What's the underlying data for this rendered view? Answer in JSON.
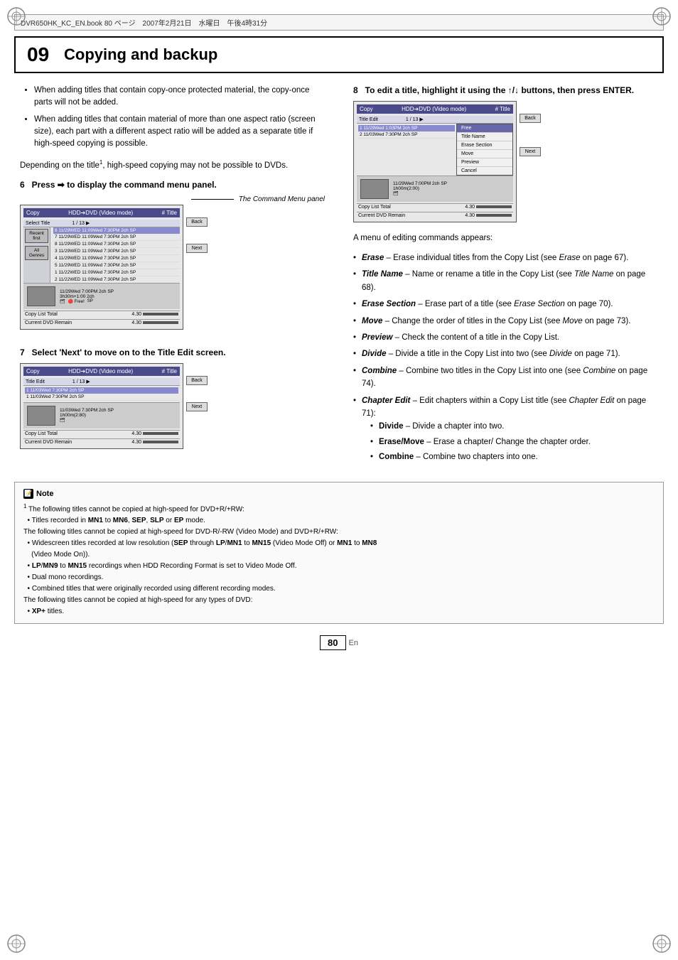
{
  "page": {
    "top_bar_text": "DVR650HK_KC_EN.book  80 ページ　2007年2月21日　水曜日　午後4時31分",
    "chapter_num": "09",
    "chapter_title": "Copying and backup",
    "page_number": "80",
    "page_lang": "En"
  },
  "left_col": {
    "bullets": [
      "When adding titles that contain copy-once protected material, the copy-once parts will not be added.",
      "When adding titles that contain material of more than one aspect ratio (screen size), each part with a different aspect ratio will be added as a separate title if high-speed copying is possible."
    ],
    "para1": "Depending on the title¹, high-speed copying may not be possible to DVDs.",
    "step6": {
      "label": "6",
      "heading": "Press ➡ to display the command menu panel.",
      "panel_label": "The Command Menu panel",
      "panel": {
        "title_left": "Copy",
        "title_mid": "HDD➔DVD (Video mode)",
        "title_right": "# Title",
        "subtitle_left": "Select Title",
        "counter": "1 / 13 ▶",
        "sidebar_items": [
          "Recent first",
          "All Genres"
        ],
        "list_items": [
          "6  11/29 WED 11:09Wed 7:30PM  2ch  SP",
          "7  11/29 WED 11:09Wed 7:30PM  2ch  SP",
          "8  11/29 WED 11:09Wed 7:30PM  2ch  SP",
          "3  11/29 WED 11:09Wed 7:30PM  2ch  SP",
          "4  11/29 WED 11:09Wed 7:30PM  2ch  SP",
          "5  11/29 WED 11:09Wed 7:30PM  2ch  SP",
          "1  11/22 WED 11:09Wed 7:30PM  2ch  SP",
          "2  11/22 WED 11:09Wed 7:30PM  2ch  SP"
        ],
        "thumbnail_time": "11/29Wed 7:00PM  2ch  SP",
        "thumbnail_size": "3h30m+1:00  2ch",
        "footer_total": "Copy List Total",
        "footer_remain": "Current DVD Remain",
        "footer_val1": "4.30",
        "footer_val2": "4.30",
        "buttons": [
          "Back",
          "Next"
        ]
      }
    },
    "step7": {
      "label": "7",
      "heading": "Select 'Next' to move on to the Title Edit screen.",
      "panel": {
        "title_left": "Copy",
        "title_mid": "HDD➔DVD (Video mode)",
        "title_right": "# Title",
        "subtitle_left": "Title Edit",
        "counter": "1 / 13 ▶",
        "list_items": [
          "1  11/03Wed 7:30PM  2ch  SP",
          "1  11/03Wed 7:30PM  2ch  SP"
        ],
        "thumbnail_time": "11/03Wed 7:30PM  2ch  SP",
        "thumbnail_size": "1h00m(2:80)",
        "footer_total": "Copy List Total",
        "footer_remain": "Current DVD Remain",
        "footer_val1": "4.30",
        "footer_val2": "4.30",
        "buttons": [
          "Back",
          "Next"
        ]
      }
    }
  },
  "right_col": {
    "step8": {
      "label": "8",
      "heading": "To edit a title, highlight it using the ↑/↓ buttons, then press ENTER.",
      "panel": {
        "title_left": "Copy",
        "title_mid": "HDD➔DVD (Video mode)",
        "title_right": "# Title",
        "subtitle_left": "Title Edit",
        "counter": "1 / 13 ▶",
        "list_items": [
          "1  11/29Wed 1:03PM  2ch  SP",
          "2  11/03Wed 7:30PM  2ch  SP"
        ],
        "context_menu": [
          {
            "label": "Free",
            "active": true
          },
          {
            "label": "Title Name",
            "active": false
          },
          {
            "label": "Erase Section",
            "active": false
          },
          {
            "label": "Move",
            "active": false
          },
          {
            "label": "Preview",
            "active": false
          },
          {
            "label": "Cancel",
            "active": false
          }
        ],
        "thumbnail_time": "11/29Wed 7:00PM  2ch  SP",
        "thumbnail_size": "1h00m(2:00)",
        "footer_total": "Copy List Total",
        "footer_remain": "Current DVD Remain",
        "footer_val1": "4.30",
        "footer_val2": "4.30",
        "buttons": [
          "Back",
          "Next"
        ]
      }
    },
    "menu_appears": "A menu of editing commands appears:",
    "bullets": [
      {
        "term": "Erase",
        "text": "– Erase individual titles from the Copy List (see ",
        "italic": "Erase",
        "page_ref": " on page 67)."
      },
      {
        "term": "Title Name",
        "text": "– Name or rename a title in the Copy List (see ",
        "italic": "Title Name",
        "page_ref": " on page 68)."
      },
      {
        "term": "Erase Section",
        "text": "– Erase part of a title (see ",
        "italic": "Erase Section",
        "page_ref": " on page 70)."
      },
      {
        "term": "Move",
        "text": "– Change the order of titles in the Copy List (see ",
        "italic": "Move",
        "page_ref": " on page 73)."
      },
      {
        "term": "Preview",
        "text": "– Check the content of a title in the Copy List."
      },
      {
        "term": "Divide",
        "text": "– Divide a title in the Copy List into two (see ",
        "italic": "Divide",
        "page_ref": " on page 71)."
      },
      {
        "term": "Combine",
        "text": "– Combine two titles in the Copy List into one (see ",
        "italic": "Combine",
        "page_ref": " on page 74)."
      },
      {
        "term": "Chapter Edit",
        "text": "– Edit chapters within a Copy List title (see ",
        "italic": "Chapter Edit",
        "page_ref": " on page 71):"
      }
    ],
    "chapter_sub": [
      "Divide – Divide a chapter into two.",
      "Erase/Move – Erase a chapter/ Change the chapter order.",
      "Combine – Combine two chapters into one."
    ]
  },
  "note": {
    "title": "Note",
    "footnote_num": "1",
    "lines": [
      "The following titles cannot be copied at high-speed for DVD+R/+RW:",
      "• Titles recorded in MN1 to MN6, SEP, SLP or EP mode.",
      "The following titles cannot be copied at high-speed for DVD-R/-RW (Video Mode) and DVD+R/+RW:",
      "• Widescreen titles recorded at low resolution (SEP through LP/MN1 to MN15 (Video Mode Off) or MN1 to MN8 (Video Mode On)).",
      "• LP/MN9 to MN15 recordings when HDD Recording Format is set to Video Mode Off.",
      "• Dual mono recordings.",
      "• Combined titles that were originally recorded using different recording modes.",
      "The following titles cannot be copied at high-speed for any types of DVD:",
      "• XP+ titles."
    ]
  }
}
